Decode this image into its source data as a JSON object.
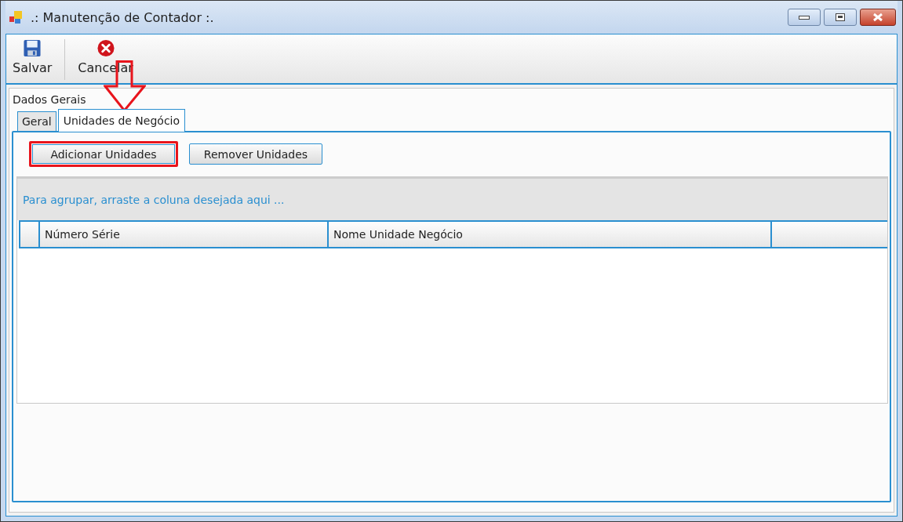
{
  "window": {
    "title": ".: Manutenção de Contador :."
  },
  "toolbar": [
    {
      "label": "Salvar",
      "kind": "save"
    },
    {
      "label": "Cancelar",
      "kind": "cancel"
    }
  ],
  "group": {
    "title": "Dados Gerais"
  },
  "tabs": [
    {
      "label": "Geral",
      "selected": false
    },
    {
      "label": "Unidades de Negócio",
      "selected": true
    }
  ],
  "buttons": [
    {
      "label": "Adicionar Unidades",
      "highlighted": true
    },
    {
      "label": "Remover Unidades",
      "highlighted": false
    }
  ],
  "grid": {
    "group_hint": "Para agrupar, arraste a coluna desejada aqui ...",
    "columns": [
      "Número Série",
      "Nome Unidade Negócio"
    ]
  }
}
